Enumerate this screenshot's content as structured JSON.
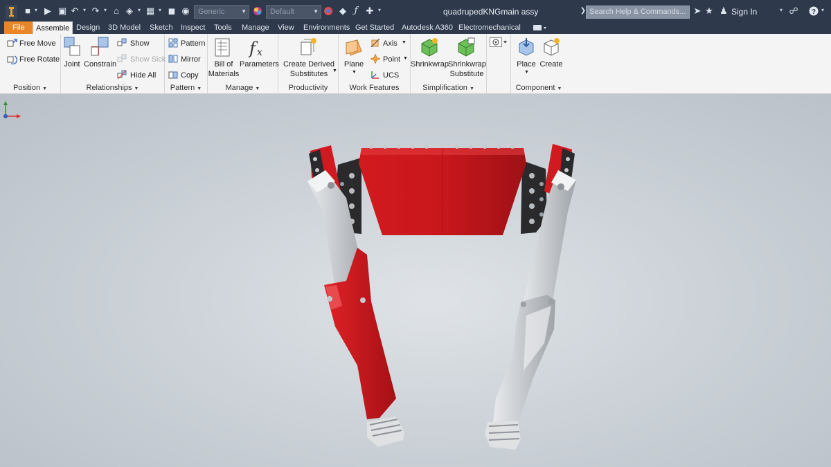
{
  "window": {
    "title": "quadrupedKNGmain assy",
    "combo_material": "Generic",
    "combo_appearance": "Default",
    "search_placeholder": "Search Help & Commands...",
    "sign_in": "Sign In"
  },
  "tabs": [
    {
      "label": "File"
    },
    {
      "label": "Assemble"
    },
    {
      "label": "Design"
    },
    {
      "label": "3D Model"
    },
    {
      "label": "Sketch"
    },
    {
      "label": "Inspect"
    },
    {
      "label": "Tools"
    },
    {
      "label": "Manage"
    },
    {
      "label": "View"
    },
    {
      "label": "Environments"
    },
    {
      "label": "Get Started"
    },
    {
      "label": "Autodesk A360"
    },
    {
      "label": "Electromechanical"
    }
  ],
  "ribbon": {
    "position": {
      "label": "Position",
      "free_move": "Free Move",
      "free_rotate": "Free Rotate"
    },
    "relationships": {
      "label": "Relationships",
      "joint": "Joint",
      "constrain": "Constrain",
      "show": "Show",
      "show_sick": "Show Sick",
      "hide_all": "Hide All"
    },
    "pattern": {
      "label": "Pattern",
      "pattern": "Pattern",
      "mirror": "Mirror",
      "copy": "Copy"
    },
    "manage": {
      "label": "Manage",
      "bill_of": "Bill of",
      "materials": "Materials",
      "parameters": "Parameters"
    },
    "productivity": {
      "label": "Productivity",
      "create_derived": "Create Derived",
      "substitutes": "Substitutes"
    },
    "work_features": {
      "label": "Work Features",
      "plane": "Plane",
      "axis": "Axis",
      "point": "Point",
      "ucs": "UCS"
    },
    "simplification": {
      "label": "Simplification",
      "shrinkwrap": "Shrinkwrap",
      "shrinkwrap2": "Shrinkwrap",
      "substitute": "Substitute"
    },
    "component": {
      "label": "Component",
      "place": "Place",
      "create": "Create"
    }
  },
  "colors": {
    "titlebar": "#2e3a4c",
    "file_tab": "#e8862a",
    "ribbon_bg": "#f4f4f4",
    "body_red": "#c8171c",
    "leg_gray": "#c9cdd1"
  }
}
